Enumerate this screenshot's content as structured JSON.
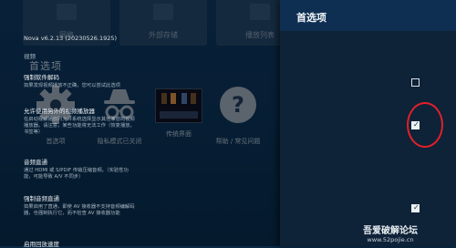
{
  "background": {
    "top_cards": [
      "网络",
      "外部存储",
      "播放列表"
    ],
    "section_title": "首选项",
    "tiles": [
      {
        "label": "首选项",
        "icon": "gear-icon"
      },
      {
        "label": "隐私模式已关闭",
        "icon": "incognito-icon"
      },
      {
        "label": "传统界面",
        "icon": "video-thumbnail"
      },
      {
        "label": "帮助 / 常见问题",
        "icon": "help-icon"
      }
    ]
  },
  "panel": {
    "title": "首选项",
    "version": "Nova v6.2.13 (20230526.1925)",
    "category_video": "视频",
    "settings": [
      {
        "title": "强制软件解码",
        "desc": "如果发现视频播放不正确，您可以尝试此选项",
        "checked": false
      },
      {
        "title": "允许使用另外的视频播放器",
        "desc": "在启动视频播放时允许系统选择显示其他兼容的视频播放器。请注意，某些功能将无法工作（恢复播放，书签等）",
        "checked": true
      },
      {
        "title": "音频直通",
        "desc": "通过 HDMI 或 S/PDIF 传输压缩音频。（实验性功能，可能导致 A/V 不同步）",
        "checked": null
      },
      {
        "title": "强制音频直通",
        "desc": "如果启用了直通，即使 AV 接收器不支持音频编解码器，也强制执行它，而不检查 AV 接收器功能",
        "checked": true
      },
      {
        "title": "启用回放速度",
        "desc": "",
        "checked": null
      }
    ]
  },
  "watermark": {
    "title": "吾爱破解论坛",
    "url": "www.52pojie.cn"
  },
  "colors": {
    "panel_bg": "#0e2238",
    "panel_header": "#0f2f52",
    "highlight": "#e0202a"
  }
}
